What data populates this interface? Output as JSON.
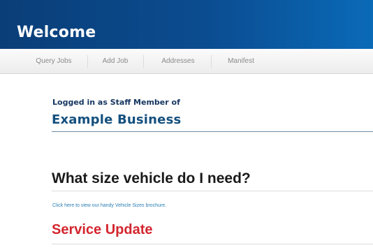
{
  "header": {
    "title": "Welcome"
  },
  "nav": {
    "items": [
      {
        "label": "Query Jobs"
      },
      {
        "label": "Add Job"
      },
      {
        "label": "Addresses"
      },
      {
        "label": "Manifest"
      }
    ]
  },
  "account": {
    "logged_in_text": "Logged in as Staff Member of",
    "business_name": "Example Business"
  },
  "vehicle_section": {
    "heading": "What size vehicle do I need?",
    "link_text": "Click here to view our handy Vehicle Sizes brochure."
  },
  "service_update": {
    "heading": "Service Update"
  },
  "colors": {
    "header_bg": "#0b4c90",
    "business_text": "#14507e",
    "link": "#2a7fb3",
    "service_heading": "#d3262e"
  }
}
